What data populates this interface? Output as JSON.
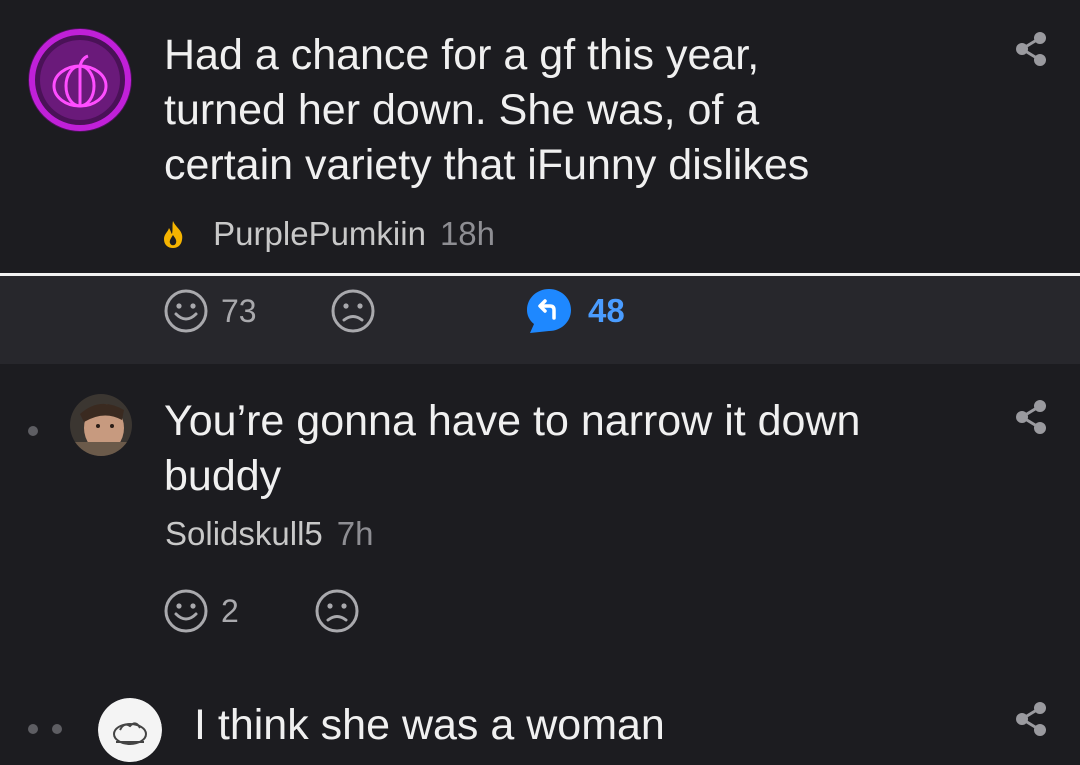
{
  "comments": [
    {
      "text": "Had a chance for a gf this year,\nturned her down. She was, of a\ncertain variety that iFunny dislikes",
      "author": "PurplePumkiin",
      "time": "18h",
      "likes": "73",
      "replies": "48"
    },
    {
      "text": "You’re gonna have to narrow it down\nbuddy",
      "author": "Solidskull5",
      "time": "7h",
      "likes": "2"
    },
    {
      "text": "I think she was a woman"
    }
  ],
  "colors": {
    "background": "#1c1c20",
    "action_bar": "#27272c",
    "reply_accent": "#1e88ff",
    "flame_icon": "#f5b400",
    "avatar_ring": "#c020d8"
  }
}
